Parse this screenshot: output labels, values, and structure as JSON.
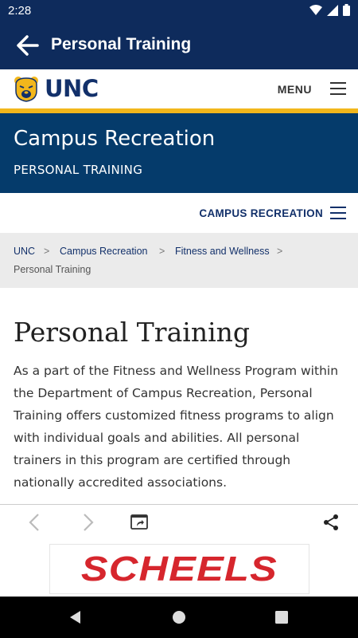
{
  "status_bar": {
    "time": "2:28"
  },
  "app_bar": {
    "title": "Personal Training"
  },
  "site_header": {
    "logo_text": "UNC",
    "menu_label": "MENU"
  },
  "hero": {
    "title": "Campus Recreation",
    "subtitle": "PERSONAL TRAINING"
  },
  "section_nav": {
    "label": "CAMPUS RECREATION"
  },
  "breadcrumb": {
    "items": [
      "UNC",
      "Campus Recreation",
      "Fitness and Wellness",
      "Personal Training"
    ],
    "separator": ">"
  },
  "content": {
    "heading": "Personal Training",
    "body": "As a part of the Fitness and Wellness Program within the Department of Campus Recreation, Personal Training offers customized fitness programs to align with individual goals and abilities. All personal trainers in this program are certified through nationally accredited associations."
  },
  "ad": {
    "text": "SCHEELS"
  },
  "colors": {
    "navy": "#0e2b5c",
    "gold": "#f2b71c",
    "hero_blue": "#053b6b",
    "ad_red": "#d6262d"
  }
}
